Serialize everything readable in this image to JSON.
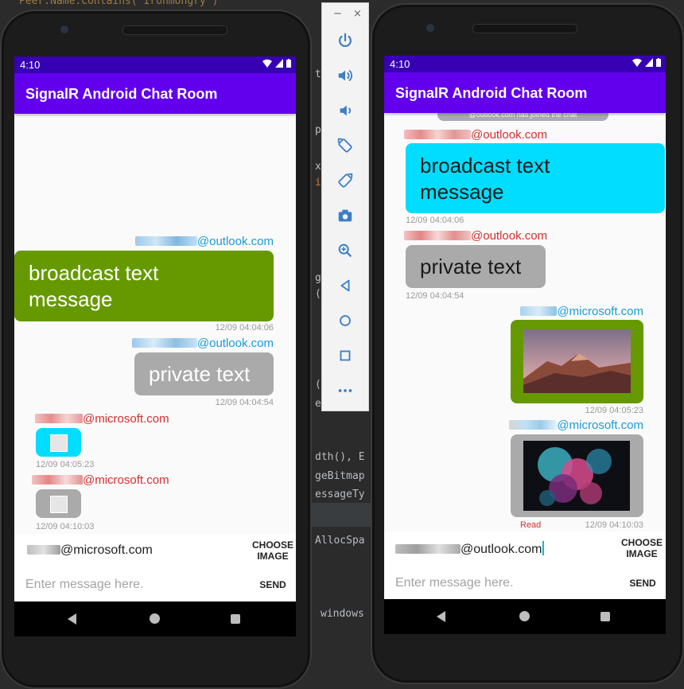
{
  "ide": {
    "lines": [
      "t",
      "p",
      "x",
      "i",
      "g",
      "(",
      "(",
      "e",
      "dth(), E",
      "geBitmap",
      "essageTy",
      "AllocSpa",
      "windows"
    ],
    "fragment_top": "Peer.Name.Contains(\"Ironmongry\")"
  },
  "emulator_toolbar": {
    "minimize": "−",
    "close": "×",
    "buttons": [
      "power-icon",
      "volume-up-icon",
      "volume-down-icon",
      "rotate-left-icon",
      "rotate-right-icon",
      "camera-icon",
      "zoom-icon",
      "back-icon",
      "home-icon",
      "overview-icon",
      "more-icon"
    ]
  },
  "colors": {
    "status_bar": "#3700b3",
    "app_bar": "#6200ee",
    "bubble_green": "#669900",
    "bubble_cyan": "#00ddff",
    "bubble_gray": "#aaaaaa",
    "sender_blue": "#1a9bd7",
    "sender_red": "#d32f2f"
  },
  "phone_left": {
    "status_time": "4:10",
    "app_title": "SignalR Android Chat Room",
    "messages": [
      {
        "sender": "@outlook.com",
        "text": "broadcast text message",
        "time": "12/09 04:04:06"
      },
      {
        "sender": "@outlook.com",
        "text": "private text",
        "time": "12/09 04:04:54"
      },
      {
        "sender": "@microsoft.com",
        "time": "12/09 04:05:23"
      },
      {
        "sender": "@microsoft.com",
        "time": "12/09 04:10:03"
      }
    ],
    "recipient": "@microsoft.com",
    "choose_image": "CHOOSE IMAGE",
    "message_placeholder": "Enter message here.",
    "send": "SEND"
  },
  "phone_right": {
    "status_time": "4:10",
    "app_title": "SignalR Android Chat Room",
    "system_notice": "@outlook.com has joined the chat",
    "messages": [
      {
        "sender": "@outlook.com",
        "text": "broadcast text message",
        "time": "12/09 04:04:06"
      },
      {
        "sender": "@outlook.com",
        "text": "private text",
        "time": "12/09 04:04:54"
      },
      {
        "sender": "@microsoft.com",
        "time": "12/09 04:05:23"
      },
      {
        "sender": "@microsoft.com",
        "time": "12/09 04:10:03",
        "status": "Read"
      }
    ],
    "recipient": "@outlook.com",
    "choose_image": "CHOOSE IMAGE",
    "message_placeholder": "Enter message here.",
    "send": "SEND"
  }
}
